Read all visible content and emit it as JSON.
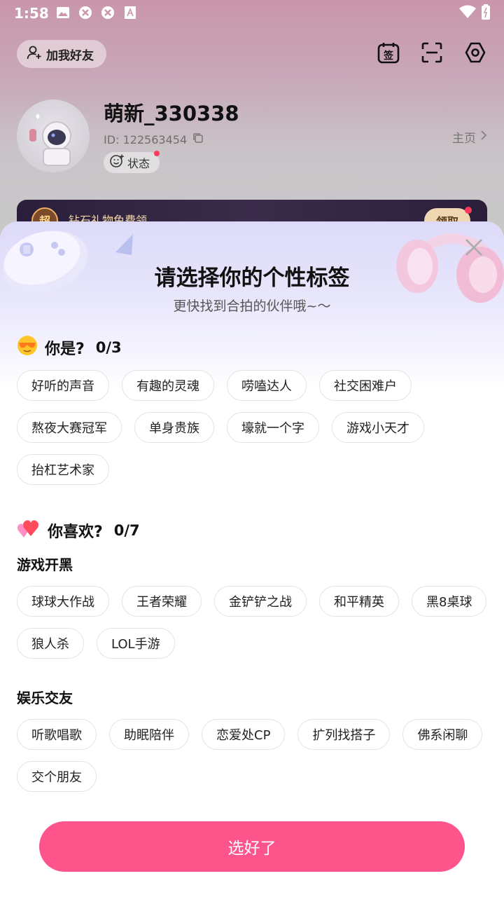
{
  "statusbar": {
    "time": "1:58",
    "icons": [
      "image-icon",
      "sync-icon",
      "sync-icon",
      "font-icon"
    ],
    "right_icons": [
      "wifi-icon",
      "battery-icon"
    ]
  },
  "profile": {
    "add_friend_label": "加我好友",
    "top_actions": [
      "sign-in-icon",
      "scan-icon",
      "settings-icon"
    ],
    "nickname": "萌新_330338",
    "user_id": "ID: 122563454",
    "status_label": "状态",
    "homepage_label": "主页"
  },
  "banner": {
    "badge": "超",
    "text": "钻石礼物免费领",
    "button": "领取"
  },
  "sheet": {
    "title": "请选择你的个性标签",
    "subtitle": "更快找到合拍的伙伴哦~〜",
    "section_you_are": {
      "label": "你是?",
      "count": "0/3",
      "tags": [
        "好听的声音",
        "有趣的灵魂",
        "唠嗑达人",
        "社交困难户",
        "熬夜大赛冠军",
        "单身贵族",
        "壕就一个字",
        "游戏小天才",
        "抬杠艺术家"
      ]
    },
    "section_you_like": {
      "label": "你喜欢?",
      "count": "0/7",
      "groups": [
        {
          "title": "游戏开黑",
          "tags": [
            "球球大作战",
            "王者荣耀",
            "金铲铲之战",
            "和平精英",
            "黑8桌球",
            "狼人杀",
            "LOL手游"
          ]
        },
        {
          "title": "娱乐交友",
          "tags": [
            "听歌唱歌",
            "助眠陪伴",
            "恋爱处CP",
            "扩列找搭子",
            "佛系闲聊",
            "交个朋友"
          ]
        }
      ]
    },
    "confirm_label": "选好了"
  },
  "colors": {
    "accent": "#fd548c",
    "sheet_gradient_top": "#dcdaf8"
  }
}
